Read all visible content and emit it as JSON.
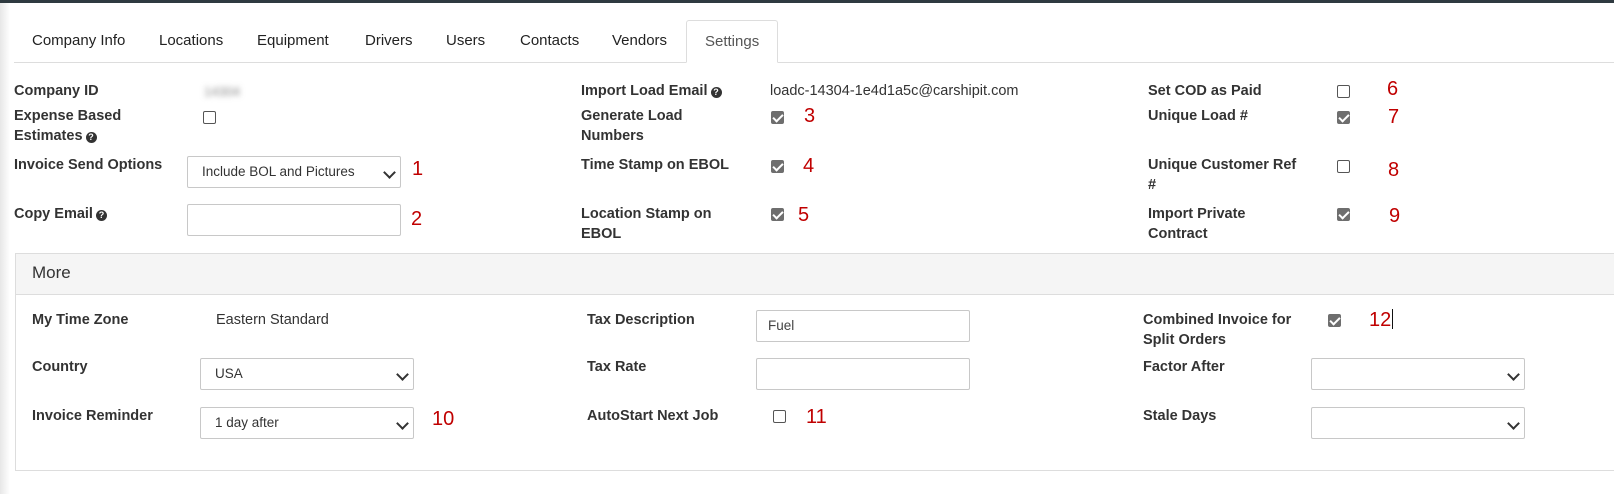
{
  "tabs": [
    "Company Info",
    "Locations",
    "Equipment",
    "Drivers",
    "Users",
    "Contacts",
    "Vendors",
    "Settings"
  ],
  "active_tab": "Settings",
  "settings": {
    "company_id_label": "Company ID",
    "company_id_value": "14304",
    "expense_based_label_1": "Expense Based",
    "expense_based_label_2": "Estimates",
    "invoice_send_label": "Invoice Send Options",
    "invoice_send_value": "Include BOL and Pictures",
    "copy_email_label": "Copy Email",
    "copy_email_value": "",
    "import_load_email_label": "Import Load Email",
    "import_load_email_value": "loadc-14304-1e4d1a5c@carshipit.com",
    "generate_load_label_1": "Generate Load",
    "generate_load_label_2": "Numbers",
    "time_stamp_label": "Time Stamp on EBOL",
    "location_stamp_label_1": "Location Stamp on",
    "location_stamp_label_2": "EBOL",
    "set_cod_label": "Set COD as Paid",
    "unique_load_label": "Unique Load #",
    "unique_customer_ref_label_1": "Unique Customer Ref",
    "unique_customer_ref_label_2": "#",
    "import_private_label_1": "Import Private",
    "import_private_label_2": "Contract"
  },
  "more": {
    "title": "More",
    "time_zone_label": "My Time Zone",
    "time_zone_value": "Eastern Standard",
    "country_label": "Country",
    "country_value": "USA",
    "invoice_reminder_label": "Invoice Reminder",
    "invoice_reminder_value": "1 day after",
    "tax_description_label": "Tax Description",
    "tax_description_value": "Fuel",
    "tax_rate_label": "Tax Rate",
    "tax_rate_value": "",
    "autostart_label": "AutoStart Next Job",
    "combined_invoice_label_1": "Combined Invoice for",
    "combined_invoice_label_2": "Split Orders",
    "factor_after_label": "Factor After",
    "factor_after_value": "",
    "stale_days_label": "Stale Days",
    "stale_days_value": ""
  },
  "checkboxes": {
    "expense_based": false,
    "generate_load_numbers": true,
    "time_stamp_ebol": true,
    "location_stamp_ebol": true,
    "set_cod_paid": false,
    "unique_load": true,
    "unique_customer_ref": false,
    "import_private_contract": true,
    "autostart_next_job": false,
    "combined_invoice": true
  },
  "annotations": [
    "1",
    "2",
    "3",
    "4",
    "5",
    "6",
    "7",
    "8",
    "9",
    "10",
    "11",
    "12"
  ],
  "colors": {
    "annotation": "#c00000",
    "topbar": "#2f3a40",
    "checked": "#6e6e6e"
  },
  "icons": {
    "help": "question-circle-icon",
    "dropdown": "chevron-down-icon"
  }
}
